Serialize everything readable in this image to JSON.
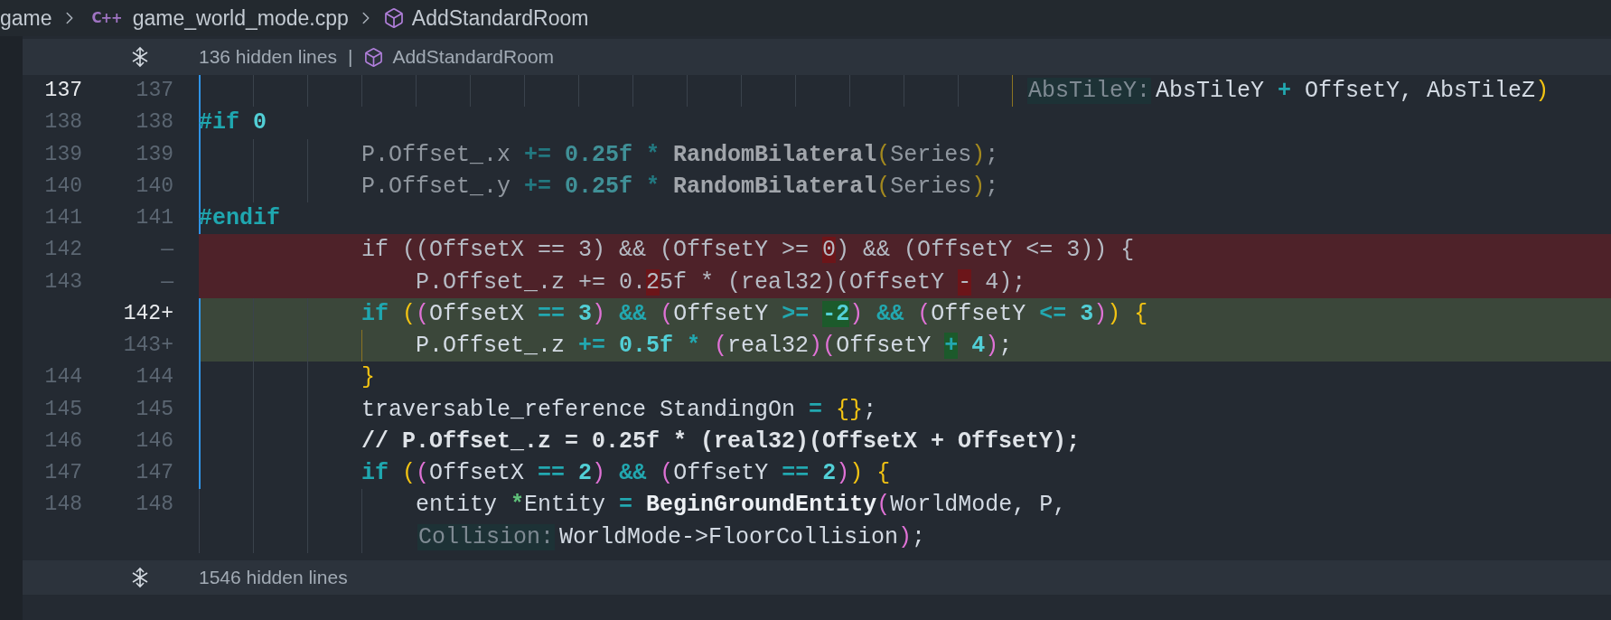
{
  "breadcrumb": {
    "items": [
      {
        "text": "game",
        "kind": "folder"
      },
      {
        "text": "game_world_mode.cpp",
        "kind": "file",
        "badge": "C++"
      },
      {
        "text": "AddStandardRoom",
        "kind": "symbol"
      }
    ]
  },
  "top_fold": {
    "hidden": "136 hidden lines",
    "separator": "|",
    "symbol": "AddStandardRoom"
  },
  "lines": [
    {
      "old": "137",
      "new": "137",
      "kind": "context",
      "current": true,
      "scope_bar": true,
      "active_guide": true,
      "inactive": false,
      "tokens": [
        {
          "text": "                                                             AbsTileY:",
          "kind": "hint"
        },
        {
          "text": "AbsTileY ",
          "kind": "plain"
        },
        {
          "text": "+",
          "kind": "op"
        },
        {
          "text": " OffsetY, AbsTileZ",
          "kind": "plain"
        },
        {
          "text": ")",
          "kind": "paren1"
        }
      ]
    },
    {
      "old": "138",
      "new": "138",
      "kind": "context",
      "current": false,
      "scope_bar": true,
      "inactive": false,
      "tokens": [
        {
          "text": "#if",
          "kind": "keyword"
        },
        {
          "text": " 0",
          "kind": "number"
        }
      ]
    },
    {
      "old": "139",
      "new": "139",
      "kind": "context",
      "current": false,
      "scope_bar": true,
      "active_guide": false,
      "inactive": true,
      "tokens": [
        {
          "text": "            P.Offset_.x ",
          "kind": "plain"
        },
        {
          "text": "+=",
          "kind": "op"
        },
        {
          "text": " 0.25f ",
          "kind": "number"
        },
        {
          "text": "*",
          "kind": "op"
        },
        {
          "text": " RandomBilateral",
          "kind": "func"
        },
        {
          "text": "(",
          "kind": "paren1"
        },
        {
          "text": "Series",
          "kind": "plain"
        },
        {
          "text": ")",
          "kind": "paren1"
        },
        {
          "text": ";",
          "kind": "plain"
        }
      ]
    },
    {
      "old": "140",
      "new": "140",
      "kind": "context",
      "current": false,
      "scope_bar": true,
      "active_guide": false,
      "inactive": true,
      "tokens": [
        {
          "text": "            P.Offset_.y ",
          "kind": "plain"
        },
        {
          "text": "+=",
          "kind": "op"
        },
        {
          "text": " 0.25f ",
          "kind": "number"
        },
        {
          "text": "*",
          "kind": "op"
        },
        {
          "text": " RandomBilateral",
          "kind": "func"
        },
        {
          "text": "(",
          "kind": "paren1"
        },
        {
          "text": "Series",
          "kind": "plain"
        },
        {
          "text": ")",
          "kind": "paren1"
        },
        {
          "text": ";",
          "kind": "plain"
        }
      ]
    },
    {
      "old": "141",
      "new": "141",
      "kind": "context",
      "current": false,
      "scope_bar": true,
      "inactive": false,
      "tokens": [
        {
          "text": "#endif",
          "kind": "keyword"
        }
      ]
    },
    {
      "old": "142",
      "marker": "—",
      "kind": "removed",
      "current": false,
      "scope_bar": false,
      "inactive": false,
      "tokens": [
        {
          "text": "            if ((OffsetX == 3) && (OffsetY >= ",
          "kind": "plain",
          "changed": false
        },
        {
          "text": "0",
          "kind": "plain",
          "changed": true
        },
        {
          "text": ") && (OffsetY <= 3)) {",
          "kind": "plain",
          "changed": false
        }
      ]
    },
    {
      "old": "143",
      "marker": "—",
      "kind": "removed",
      "current": false,
      "scope_bar": false,
      "inactive": false,
      "tokens": [
        {
          "text": "                P.Offset_.z += 0.",
          "kind": "plain",
          "changed": false
        },
        {
          "text": "2",
          "kind": "plain",
          "changed": true
        },
        {
          "text": "5f * (real32)(OffsetY ",
          "kind": "plain",
          "changed": false
        },
        {
          "text": "-",
          "kind": "plain",
          "changed": true
        },
        {
          "text": " 4);",
          "kind": "plain",
          "changed": false
        }
      ]
    },
    {
      "new": "142",
      "marker": "+",
      "kind": "added",
      "current": true,
      "scope_bar": true,
      "active_guide": false,
      "inactive": false,
      "tokens": [
        {
          "text": "            if ",
          "kind": "keyword",
          "changed": false
        },
        {
          "text": "(",
          "kind": "paren1",
          "changed": false
        },
        {
          "text": "(",
          "kind": "paren2",
          "changed": false
        },
        {
          "text": "OffsetX ",
          "kind": "plain",
          "changed": false
        },
        {
          "text": "==",
          "kind": "op",
          "changed": false
        },
        {
          "text": " 3",
          "kind": "number",
          "changed": false
        },
        {
          "text": ") ",
          "kind": "paren2",
          "changed": false
        },
        {
          "text": "&&",
          "kind": "op",
          "changed": false
        },
        {
          "text": " (",
          "kind": "paren2",
          "changed": false
        },
        {
          "text": "OffsetY ",
          "kind": "plain",
          "changed": false
        },
        {
          "text": ">= ",
          "kind": "op",
          "changed": false
        },
        {
          "text": "-2",
          "kind": "number",
          "changed": true
        },
        {
          "text": ") ",
          "kind": "paren2",
          "changed": false
        },
        {
          "text": "&&",
          "kind": "op",
          "changed": false
        },
        {
          "text": " (",
          "kind": "paren2",
          "changed": false
        },
        {
          "text": "OffsetY ",
          "kind": "plain",
          "changed": false
        },
        {
          "text": "<=",
          "kind": "op",
          "changed": false
        },
        {
          "text": " 3",
          "kind": "number",
          "changed": false
        },
        {
          "text": ")",
          "kind": "paren2",
          "changed": false
        },
        {
          "text": ") {",
          "kind": "paren1",
          "changed": false
        }
      ]
    },
    {
      "new": "143",
      "marker": "+",
      "kind": "added",
      "current": false,
      "scope_bar": true,
      "active_guide": true,
      "inactive": false,
      "tokens": [
        {
          "text": "                P.Offset_.z ",
          "kind": "plain",
          "changed": false
        },
        {
          "text": "+=",
          "kind": "op",
          "changed": false
        },
        {
          "text": " 0.5f ",
          "kind": "number",
          "changed": false
        },
        {
          "text": "*",
          "kind": "op",
          "changed": false
        },
        {
          "text": " (",
          "kind": "paren2",
          "changed": false
        },
        {
          "text": "real32",
          "kind": "plain",
          "changed": false
        },
        {
          "text": ")(",
          "kind": "paren2",
          "changed": false
        },
        {
          "text": "OffsetY ",
          "kind": "plain",
          "changed": false
        },
        {
          "text": "+",
          "kind": "op",
          "changed": true
        },
        {
          "text": " 4",
          "kind": "number",
          "changed": false
        },
        {
          "text": ")",
          "kind": "paren2",
          "changed": false
        },
        {
          "text": ";",
          "kind": "plain",
          "changed": false
        }
      ]
    },
    {
      "old": "144",
      "new": "144",
      "kind": "context",
      "current": false,
      "scope_bar": true,
      "active_guide": false,
      "inactive": false,
      "tokens": [
        {
          "text": "            }",
          "kind": "paren1"
        }
      ]
    },
    {
      "old": "145",
      "new": "145",
      "kind": "context",
      "current": false,
      "scope_bar": true,
      "active_guide": false,
      "inactive": false,
      "tokens": [
        {
          "text": "            traversable_reference StandingOn ",
          "kind": "plain"
        },
        {
          "text": "=",
          "kind": "op"
        },
        {
          "text": " {}",
          "kind": "paren1"
        },
        {
          "text": ";",
          "kind": "plain"
        }
      ]
    },
    {
      "old": "146",
      "new": "146",
      "kind": "context",
      "current": false,
      "scope_bar": true,
      "active_guide": false,
      "inactive": false,
      "tokens": [
        {
          "text": "            // P.Offset_.z = 0.25f * (real32)(OffsetX + OffsetY);",
          "kind": "comment"
        }
      ]
    },
    {
      "old": "147",
      "new": "147",
      "kind": "context",
      "current": false,
      "scope_bar": true,
      "active_guide": false,
      "inactive": false,
      "tokens": [
        {
          "text": "            if ",
          "kind": "keyword"
        },
        {
          "text": "(",
          "kind": "paren1"
        },
        {
          "text": "(",
          "kind": "paren2"
        },
        {
          "text": "OffsetX ",
          "kind": "plain"
        },
        {
          "text": "==",
          "kind": "op"
        },
        {
          "text": " 2",
          "kind": "number"
        },
        {
          "text": ") ",
          "kind": "paren2"
        },
        {
          "text": "&&",
          "kind": "op"
        },
        {
          "text": " (",
          "kind": "paren2"
        },
        {
          "text": "OffsetY ",
          "kind": "plain"
        },
        {
          "text": "==",
          "kind": "op"
        },
        {
          "text": " 2",
          "kind": "number"
        },
        {
          "text": ")",
          "kind": "paren2"
        },
        {
          "text": ") {",
          "kind": "paren1"
        }
      ]
    },
    {
      "old": "148",
      "new": "148",
      "kind": "context",
      "current": false,
      "scope_bar": false,
      "active_guide": false,
      "inactive": false,
      "tokens": [
        {
          "text": "                entity ",
          "kind": "plain"
        },
        {
          "text": "*",
          "kind": "ptr"
        },
        {
          "text": "Entity ",
          "kind": "plain"
        },
        {
          "text": "=",
          "kind": "op"
        },
        {
          "text": " BeginGroundEntity",
          "kind": "func"
        },
        {
          "text": "(",
          "kind": "paren2"
        },
        {
          "text": "WorldMode, P,",
          "kind": "plain"
        }
      ],
      "wrap_tokens": [
        {
          "text": "                Collision:",
          "kind": "hint"
        },
        {
          "text": "WorldMode->FloorCollision",
          "kind": "plain"
        },
        {
          "text": ")",
          "kind": "paren2"
        },
        {
          "text": ";",
          "kind": "plain"
        }
      ]
    }
  ],
  "bottom_fold": {
    "hidden": "1546 hidden lines"
  }
}
